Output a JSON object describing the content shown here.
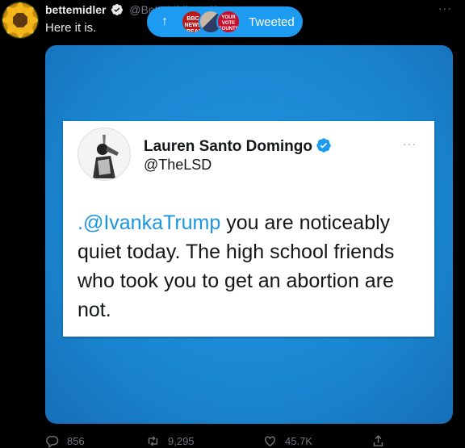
{
  "tweet": {
    "display_name": "bettemidler",
    "handle": "@BetteMidler · 3h",
    "text": "Here it is.",
    "more": "···"
  },
  "new_tweets_pill": {
    "arrow": "↑",
    "avatar_bbc": "BBC NEWS BREAKING",
    "avatar_vote": "YOUR VOTE COUNTS",
    "label": "Tweeted"
  },
  "embedded_tweet": {
    "display_name": "Lauren Santo Domingo",
    "handle": "@TheLSD",
    "more": "···",
    "mention": ".@IvankaTrump",
    "text": " you are noticeably quiet today. The high school friends who took you to get an abortion are not."
  },
  "actions": {
    "replies": "856",
    "retweets": "9,295",
    "likes": "45.7K"
  },
  "colors": {
    "accent": "#1d9bf0",
    "background": "#000000",
    "media_blue": "#1a86d2"
  }
}
